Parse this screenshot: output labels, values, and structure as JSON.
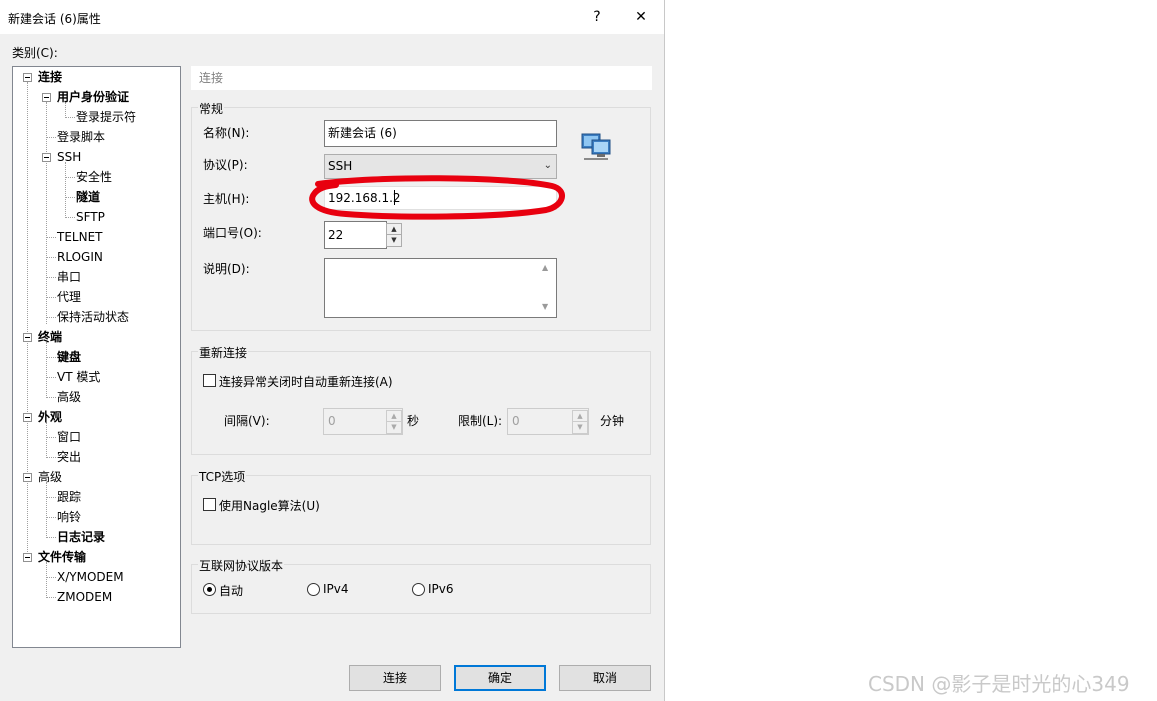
{
  "window": {
    "title": "新建会话 (6)属性",
    "help_icon": "?",
    "close_icon": "✕"
  },
  "category_label": "类别(C):",
  "tree": {
    "connection": "连接",
    "user_auth": "用户身份验证",
    "login_prompt": "登录提示符",
    "login_script": "登录脚本",
    "ssh": "SSH",
    "security": "安全性",
    "tunnel": "隧道",
    "sftp": "SFTP",
    "telnet": "TELNET",
    "rlogin": "RLOGIN",
    "serial": "串口",
    "proxy": "代理",
    "keepalive": "保持活动状态",
    "terminal": "终端",
    "keyboard": "键盘",
    "vt_mode": "VT 模式",
    "terminal_advanced": "高级",
    "appearance": "外观",
    "window": "窗口",
    "highlight": "突出",
    "advanced": "高级",
    "trace": "跟踪",
    "bell": "响铃",
    "logging": "日志记录",
    "file_transfer": "文件传输",
    "xymodem": "X/YMODEM",
    "zmodem": "ZMODEM"
  },
  "header": "连接",
  "general": {
    "title": "常规",
    "name_label": "名称(N):",
    "name_value": "新建会话 (6)",
    "protocol_label": "协议(P):",
    "protocol_value": "SSH",
    "host_label": "主机(H):",
    "host_value": "192.168.1.2",
    "port_label": "端口号(O):",
    "port_value": "22",
    "desc_label": "说明(D):",
    "desc_value": ""
  },
  "reconnect": {
    "title": "重新连接",
    "auto_reconnect_label": "连接异常关闭时自动重新连接(A)",
    "interval_label": "间隔(V):",
    "interval_value": "0",
    "seconds_unit": "秒",
    "limit_label": "限制(L):",
    "limit_value": "0",
    "minutes_unit": "分钟"
  },
  "tcp": {
    "title": "TCP选项",
    "nagle_label": "使用Nagle算法(U)"
  },
  "ip_version": {
    "title": "互联网协议版本",
    "auto": "自动",
    "ipv4": "IPv4",
    "ipv6": "IPv6",
    "selected": "自动"
  },
  "buttons": {
    "connect": "连接",
    "ok": "确定",
    "cancel": "取消"
  },
  "watermark": "CSDN @影子是时光的心349",
  "colors": {
    "annotation_red": "#e8000f",
    "default_button_border": "#0078d7"
  }
}
